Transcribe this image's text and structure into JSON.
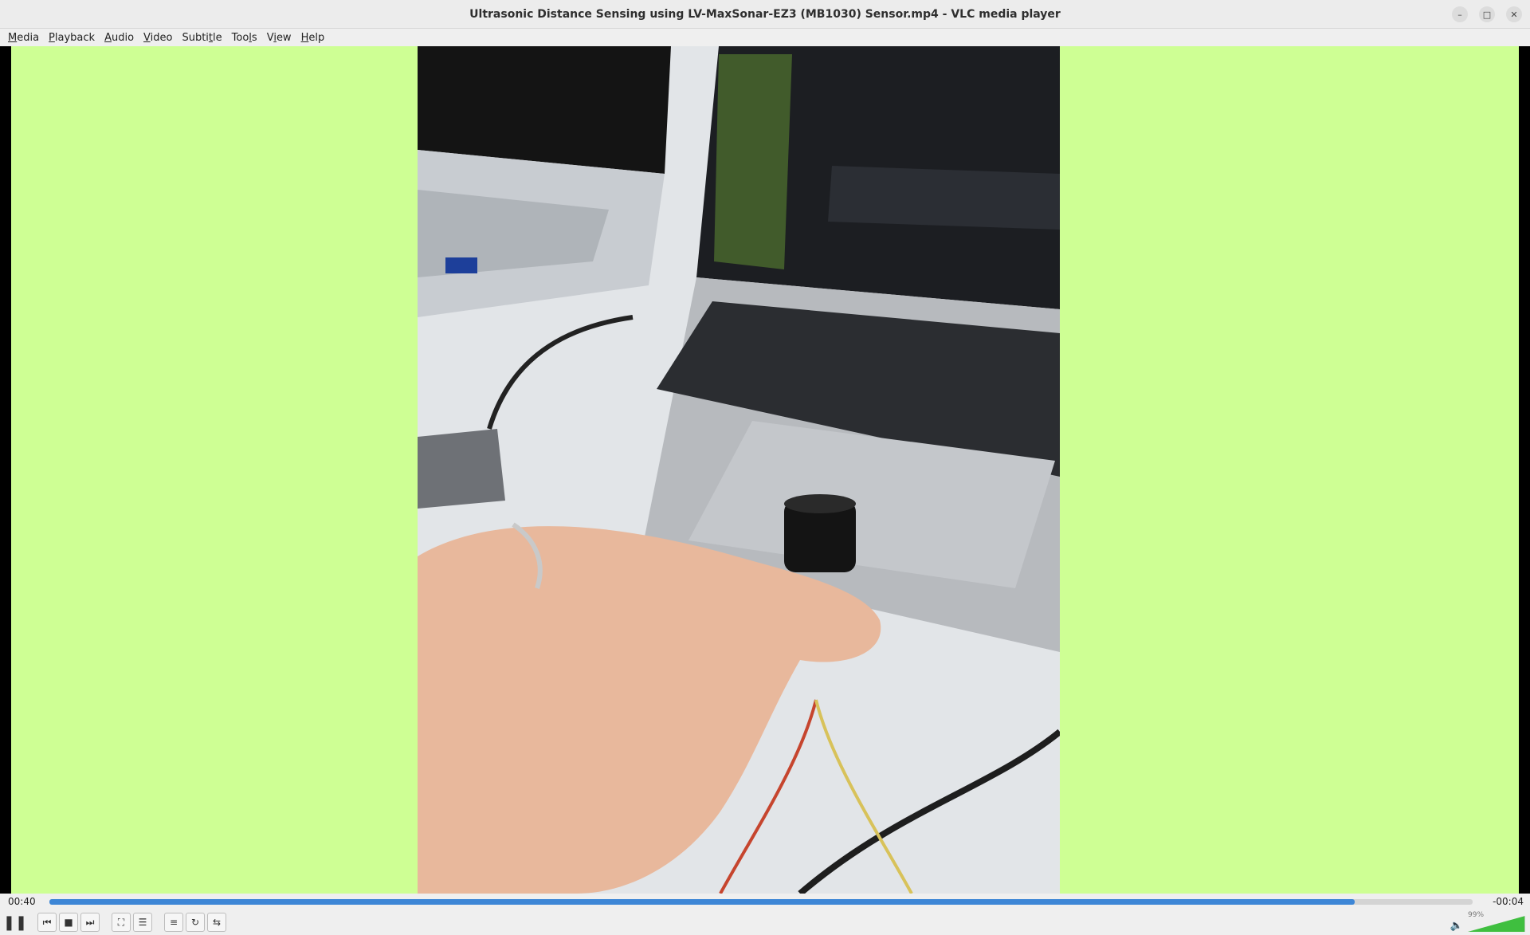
{
  "window": {
    "title": "Ultrasonic Distance Sensing using LV-MaxSonar-EZ3 (MB1030) Sensor.mp4 - VLC media player",
    "controls": [
      "minimize-icon",
      "maximize-icon",
      "close-icon"
    ]
  },
  "menu": {
    "items": [
      {
        "mnemonic": "M",
        "rest": "edia"
      },
      {
        "mnemonic": "P",
        "rest": "layback"
      },
      {
        "mnemonic": "A",
        "rest": "udio"
      },
      {
        "mnemonic": "V",
        "rest": "ideo"
      },
      {
        "pre": "Subti",
        "mnemonic": "t",
        "rest": "le"
      },
      {
        "pre": "Too",
        "mnemonic": "l",
        "rest": "s"
      },
      {
        "pre": "V",
        "mnemonic": "i",
        "rest": "ew"
      },
      {
        "mnemonic": "H",
        "rest": "elp"
      }
    ]
  },
  "playback": {
    "elapsed": "00:40",
    "remaining": "-00:04",
    "progress": 0.917
  },
  "controls": {
    "icons": [
      "pause-icon",
      "previous-icon",
      "stop-icon",
      "next-icon",
      "fullscreen-icon",
      "extended-settings-icon",
      "playlist-icon",
      "loop-icon",
      "shuffle-icon"
    ]
  },
  "volume": {
    "label": "99%",
    "level": 0.99
  },
  "colors": {
    "canvas_bg": "#ceff94",
    "seek_fill": "#3d86d6",
    "volume_fill": "#3fbf3f"
  }
}
